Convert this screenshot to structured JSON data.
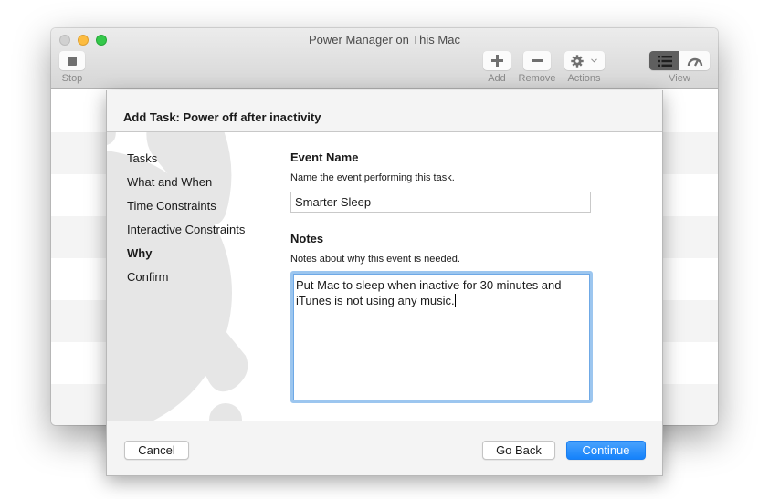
{
  "window": {
    "title": "Power Manager on This Mac",
    "traffic_lights": [
      "close",
      "minimize",
      "zoom"
    ]
  },
  "toolbar": {
    "stop": {
      "label": "Stop",
      "icon": "stop-icon"
    },
    "add": {
      "label": "Add",
      "icon": "plus-icon"
    },
    "remove": {
      "label": "Remove",
      "icon": "minus-icon"
    },
    "actions": {
      "label": "Actions",
      "icon": "gear-icon",
      "has_dropdown": true
    },
    "view": {
      "label": "View",
      "options": [
        "list-icon",
        "gauge-icon"
      ],
      "selected": "list-icon"
    }
  },
  "sheet": {
    "title": "Add Task: Power off after inactivity",
    "steps": [
      {
        "label": "Tasks",
        "active": false
      },
      {
        "label": "What and When",
        "active": false
      },
      {
        "label": "Time Constraints",
        "active": false
      },
      {
        "label": "Interactive Constraints",
        "active": false
      },
      {
        "label": "Why",
        "active": true
      },
      {
        "label": "Confirm",
        "active": false
      }
    ],
    "event_name": {
      "title": "Event Name",
      "description": "Name the event performing this task.",
      "value": "Smarter Sleep"
    },
    "notes": {
      "title": "Notes",
      "description": "Notes about why this event is needed.",
      "value": "Put Mac to sleep when inactive for 30 minutes and iTunes is not using any music."
    },
    "buttons": {
      "cancel": "Cancel",
      "go_back": "Go Back",
      "continue": "Continue"
    }
  },
  "colors": {
    "accent": "#1a82fb",
    "focus_ring": "#9cc6ef",
    "traffic_close": "#d1d1d1",
    "traffic_minimize": "#fdbc40",
    "traffic_zoom": "#34c84a"
  }
}
